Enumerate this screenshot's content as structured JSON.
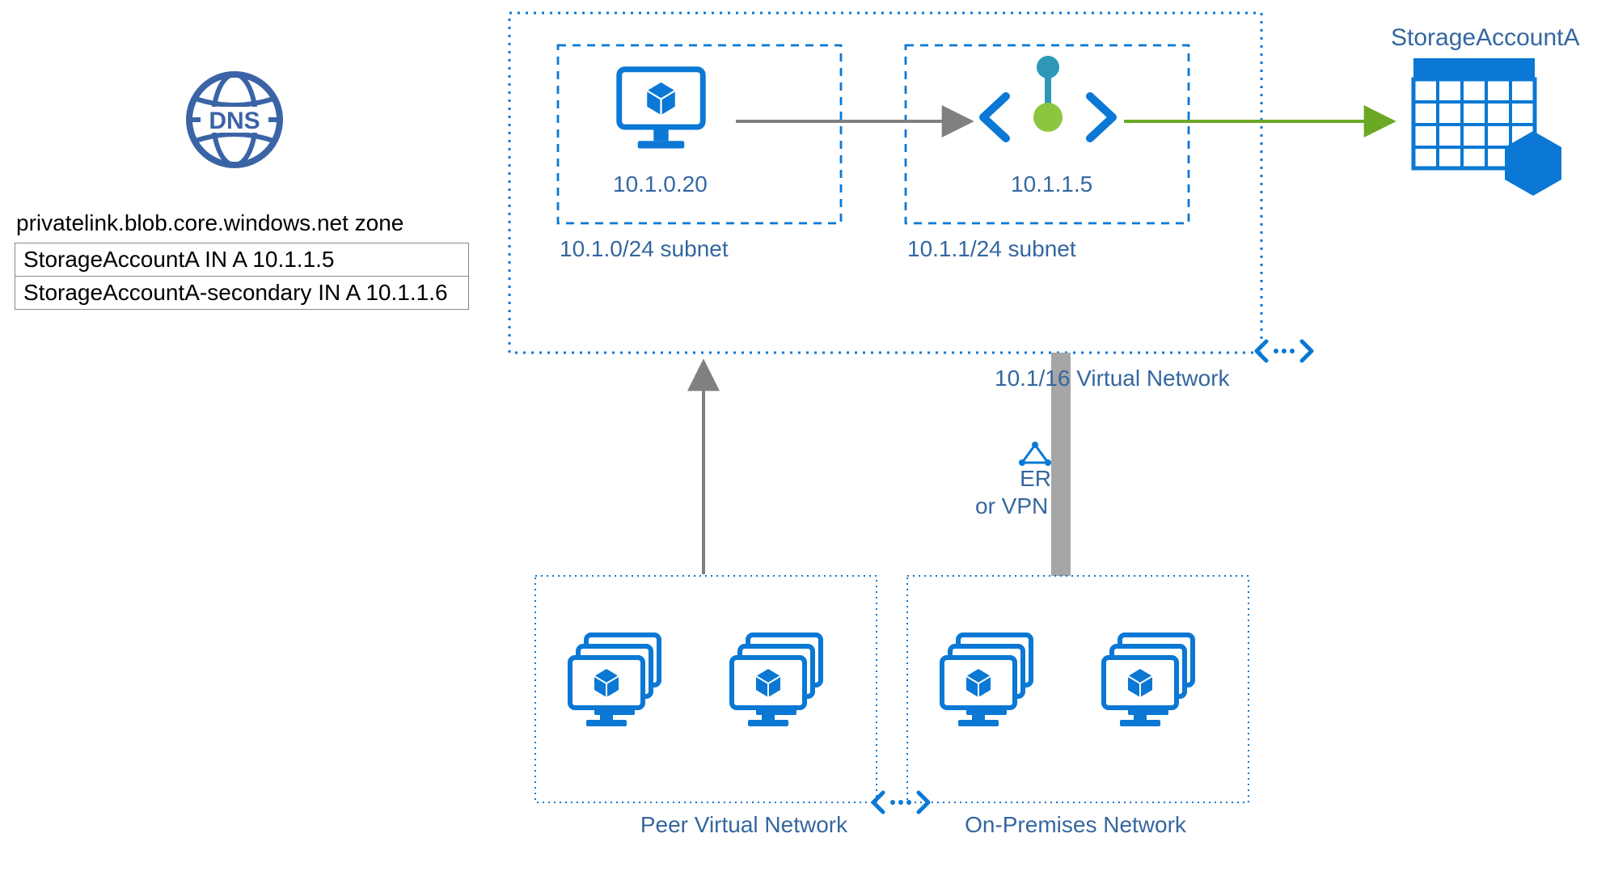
{
  "dns": {
    "zone_caption": "privatelink.blob.core.windows.net zone",
    "records": [
      "StorageAccountA IN A 10.1.1.5",
      "StorageAccountA-secondary IN A 10.1.1.6"
    ]
  },
  "vnet": {
    "label": "10.1/16 Virtual Network",
    "subnet_a": {
      "label": "10.1.0/24 subnet",
      "vm_ip": "10.1.0.20"
    },
    "subnet_b": {
      "label": "10.1.1/24 subnet",
      "endpoint_ip": "10.1.1.5"
    }
  },
  "storage": {
    "title": "StorageAccountA"
  },
  "peer_network": {
    "label": "Peer Virtual Network"
  },
  "onprem_network": {
    "label": "On-Premises Network"
  },
  "gateway": {
    "er_label": "ER",
    "vpn_label": "or VPN"
  },
  "icons": {
    "dns": "dns-icon",
    "vm": "vm-icon",
    "endpoint": "private-link-icon",
    "storage": "storage-account-icon",
    "vnet": "vnet-icon",
    "gateway": "gateway-icon"
  }
}
